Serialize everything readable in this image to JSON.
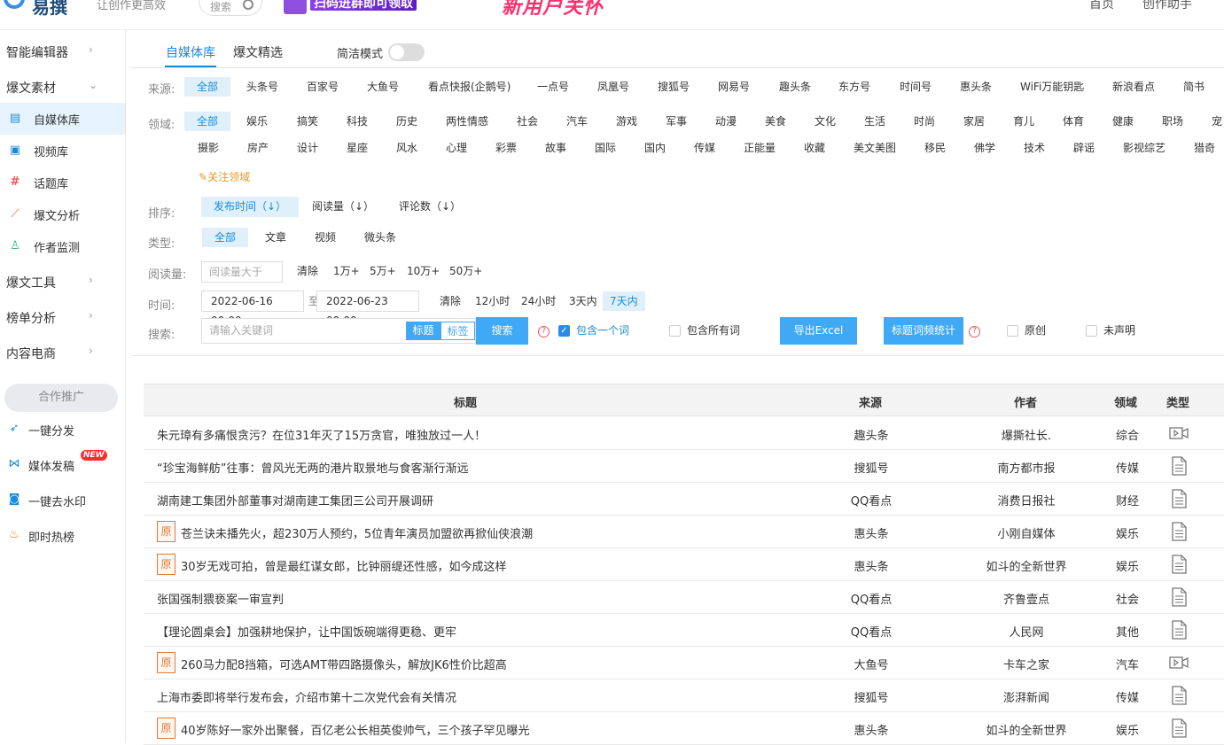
{
  "header": {
    "logo_text": "易撰",
    "slogan": "让创作更高效",
    "search_placeholder": "搜索",
    "banner1_text": "扫码进群即可领取",
    "banner2_text": "新用户关怀",
    "nav": [
      "首页",
      "创作助手"
    ]
  },
  "sidebar": {
    "groups": {
      "smart_editor": "智能编辑器",
      "material": "爆文素材",
      "tools": "爆文工具",
      "rank": "榜单分析",
      "ecommerce": "内容电商"
    },
    "material_items": [
      {
        "label": "自媒体库",
        "icon": "document-icon"
      },
      {
        "label": "视频库",
        "icon": "video-icon"
      },
      {
        "label": "话题库",
        "icon": "hash-icon"
      },
      {
        "label": "爆文分析",
        "icon": "chart-icon"
      },
      {
        "label": "作者监测",
        "icon": "user-add-icon"
      }
    ],
    "coop_label": "合作推广",
    "coop_items": [
      {
        "label": "一键分发"
      },
      {
        "label": "媒体发稿"
      },
      {
        "label": "一键去水印"
      },
      {
        "label": "即时热榜"
      }
    ],
    "new_badge": "NEW"
  },
  "tabs": [
    "自媒体库",
    "爆文精选"
  ],
  "simple_mode_label": "简洁模式",
  "filters": {
    "source_label": "来源:",
    "sources": [
      "全部",
      "头条号",
      "百家号",
      "大鱼号",
      "看点快报(企鹅号)",
      "一点号",
      "凤凰号",
      "搜狐号",
      "网易号",
      "趣头条",
      "东方号",
      "时间号",
      "惠头条",
      "WiFi万能钥匙",
      "新浪看点",
      "简书"
    ],
    "domain_label": "领域:",
    "domains_row1": [
      "全部",
      "娱乐",
      "搞笑",
      "科技",
      "历史",
      "两性情感",
      "社会",
      "汽车",
      "游戏",
      "军事",
      "动漫",
      "美食",
      "文化",
      "生活",
      "时尚",
      "家居",
      "育儿",
      "体育",
      "健康",
      "职场",
      "宠"
    ],
    "domains_row2": [
      "摄影",
      "房产",
      "设计",
      "星座",
      "风水",
      "心理",
      "彩票",
      "故事",
      "国际",
      "国内",
      "传媒",
      "正能量",
      "收藏",
      "美文美图",
      "移民",
      "佛学",
      "技术",
      "辟谣",
      "影视综艺",
      "猎奇"
    ],
    "follow_domain": "关注领域",
    "sort_label": "排序:",
    "sorts": [
      "发布时间（↓）",
      "阅读量（↓）",
      "评论数（↓）"
    ],
    "type_label": "类型:",
    "types": [
      "全部",
      "文章",
      "视频",
      "微头条"
    ],
    "reads_label": "阅读量:",
    "reads_placeholder": "阅读量大于",
    "reads_clear": "清除",
    "reads_options": [
      "1万+",
      "5万+",
      "10万+",
      "50万+"
    ],
    "time_label": "时间:",
    "date_from": "2022-06-16 00:00",
    "date_to_sep": "至",
    "date_to": "2022-06-23 00:00",
    "time_clear": "清除",
    "time_options": [
      "12小时",
      "24小时",
      "3天内",
      "7天内"
    ],
    "search_label": "搜索:",
    "search_placeholder": "请输入关键词",
    "search_scope": [
      "标题",
      "标签"
    ],
    "search_button": "搜索",
    "contains_one": "包含一个词",
    "contains_all": "包含所有词",
    "export_button": "导出Excel",
    "word_stat_button": "标题词频统计",
    "original": "原创",
    "undeclared": "未声明"
  },
  "table": {
    "headers": [
      "标题",
      "来源",
      "作者",
      "领域",
      "类型"
    ],
    "rows": [
      {
        "original": false,
        "title": "朱元璋有多痛恨贪污？在位31年灭了15万贪官，唯独放过一人！",
        "source": "趣头条",
        "author": "爆撕社长.",
        "domain": "综合",
        "type": "video-icon"
      },
      {
        "original": false,
        "title": "“珍宝海鲜舫”往事：曾风光无两的港片取景地与食客渐行渐远",
        "source": "搜狐号",
        "author": "南方都市报",
        "domain": "传媒",
        "type": "article-icon"
      },
      {
        "original": false,
        "title": "湖南建工集团外部董事对湖南建工集团三公司开展调研",
        "source": "QQ看点",
        "author": "消费日报社",
        "domain": "财经",
        "type": "article-icon"
      },
      {
        "original": true,
        "title": "苍兰诀未播先火，超230万人预约，5位青年演员加盟欲再掀仙侠浪潮",
        "source": "惠头条",
        "author": "小刚自媒体",
        "domain": "娱乐",
        "type": "article-icon"
      },
      {
        "original": true,
        "title": "30岁无戏可拍，曾是最红谋女郎，比钟丽缇还性感，如今成这样",
        "source": "惠头条",
        "author": "如斗的全新世界",
        "domain": "娱乐",
        "type": "article-icon"
      },
      {
        "original": false,
        "title": "张国强制猥亵案一审宣判",
        "source": "QQ看点",
        "author": "齐鲁壹点",
        "domain": "社会",
        "type": "article-icon"
      },
      {
        "original": false,
        "title": "【理论圆桌会】加强耕地保护，让中国饭碗端得更稳、更牢",
        "source": "QQ看点",
        "author": "人民网",
        "domain": "其他",
        "type": "article-icon"
      },
      {
        "original": true,
        "title": "260马力配8挡箱，可选AMT带四路摄像头，解放JK6性价比超高",
        "source": "大鱼号",
        "author": "卡车之家",
        "domain": "汽车",
        "type": "video-icon"
      },
      {
        "original": false,
        "title": "上海市委即将举行发布会，介绍市第十二次党代会有关情况",
        "source": "搜狐号",
        "author": "澎湃新闻",
        "domain": "传媒",
        "type": "article-icon"
      },
      {
        "original": true,
        "title": "40岁陈好一家外出聚餐，百亿老公长相英俊帅气，三个孩子罕见曝光",
        "source": "惠头条",
        "author": "如斗的全新世界",
        "domain": "娱乐",
        "type": "article-icon"
      }
    ],
    "original_badge": "原"
  },
  "colors": {
    "accent": "#1a8bd8",
    "button": "#3fa9f5",
    "original": "#e07a3a"
  }
}
